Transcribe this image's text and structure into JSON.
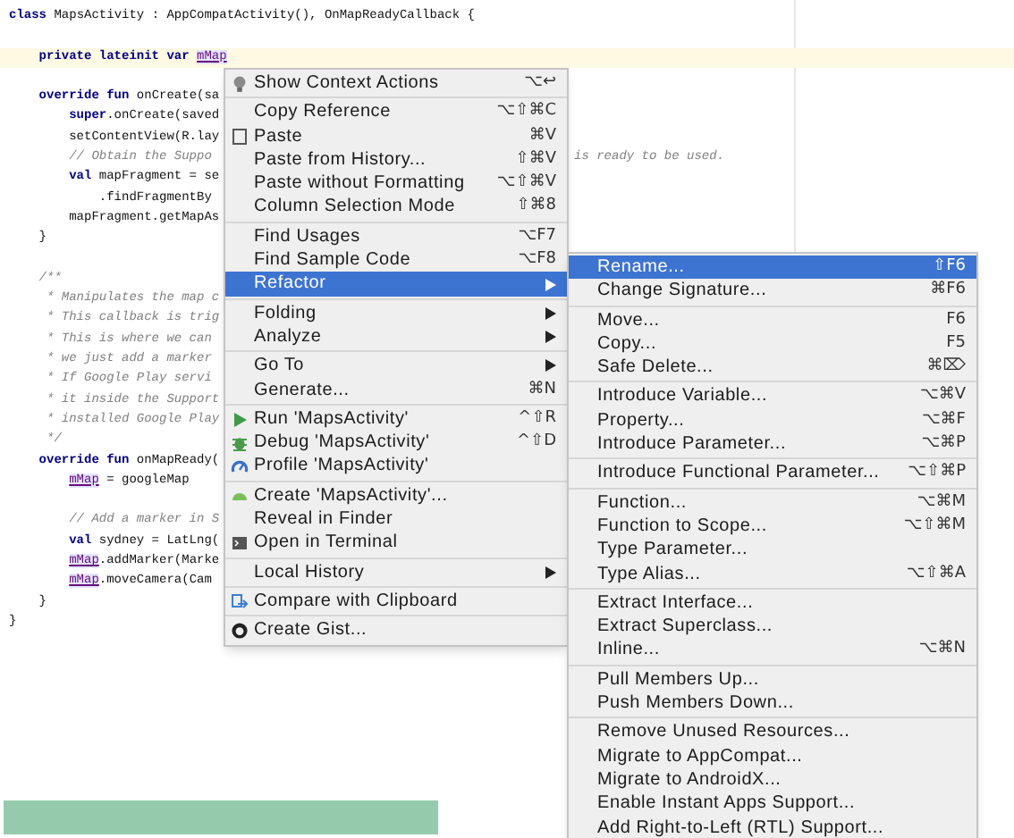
{
  "editor": {
    "lines": [
      {
        "kind": "code",
        "current": false,
        "segments": [
          {
            "kind": "keyword",
            "text": "class"
          },
          {
            "kind": "plain",
            "text": " MapsActivity : AppCompatActivity(), OnMapReadyCallback {"
          }
        ],
        "children": [
          {
            "kind": "blank",
            "current": false
          },
          {
            "kind": "code",
            "current": true,
            "segments": [
              {
                "kind": "keyword",
                "text": "private lateinit var "
              },
              {
                "kind": "field",
                "text": "mMap"
              }
            ]
          },
          {
            "kind": "blank",
            "current": false
          },
          {
            "kind": "code",
            "current": false,
            "segments": [
              {
                "kind": "keyword",
                "text": "override fun"
              },
              {
                "kind": "plain",
                "text": " onCreate(sa"
              }
            ],
            "children": [
              {
                "kind": "code",
                "current": false,
                "segments": [
                  {
                    "kind": "keyword",
                    "text": "super"
                  },
                  {
                    "kind": "plain",
                    "text": ".onCreate(saved"
                  }
                ]
              },
              {
                "kind": "code",
                "current": false,
                "segments": [
                  {
                    "kind": "plain",
                    "text": "setContentView(R.lay"
                  }
                ]
              },
              {
                "kind": "code",
                "current": false,
                "segments": [
                  {
                    "kind": "comment",
                    "text": "// Obtain the Suppo"
                  }
                ],
                "tail": "is ready to be used."
              },
              {
                "kind": "code",
                "current": false,
                "segments": [
                  {
                    "kind": "keyword",
                    "text": "val"
                  },
                  {
                    "kind": "plain",
                    "text": " mapFragment = se"
                  }
                ],
                "children": [
                  {
                    "kind": "code",
                    "current": false,
                    "segments": [
                      {
                        "kind": "plain",
                        "text": ".findFragmentBy"
                      }
                    ]
                  }
                ]
              },
              {
                "kind": "code",
                "current": false,
                "segments": [
                  {
                    "kind": "plain",
                    "text": "mapFragment.getMapAs"
                  }
                ]
              }
            ]
          },
          {
            "kind": "code",
            "current": false,
            "segments": [
              {
                "kind": "plain",
                "text": "}"
              }
            ]
          },
          {
            "kind": "blank",
            "current": false
          },
          {
            "kind": "code",
            "current": false,
            "segments": [
              {
                "kind": "comment",
                "text": "/**"
              }
            ]
          },
          {
            "kind": "code",
            "current": false,
            "segments": [
              {
                "kind": "comment",
                "text": " * Manipulates the map c"
              }
            ]
          },
          {
            "kind": "code",
            "current": false,
            "segments": [
              {
                "kind": "comment",
                "text": " * This callback is trig"
              }
            ]
          },
          {
            "kind": "code",
            "current": false,
            "segments": [
              {
                "kind": "comment",
                "text": " * This is where we can"
              }
            ]
          },
          {
            "kind": "code",
            "current": false,
            "segments": [
              {
                "kind": "comment",
                "text": " * we just add a marker"
              }
            ]
          },
          {
            "kind": "code",
            "current": false,
            "segments": [
              {
                "kind": "comment",
                "text": " * If Google Play servi"
              }
            ]
          },
          {
            "kind": "code",
            "current": false,
            "segments": [
              {
                "kind": "comment",
                "text": " * it inside the Support"
              }
            ]
          },
          {
            "kind": "code",
            "current": false,
            "segments": [
              {
                "kind": "comment",
                "text": " * installed Google Play"
              }
            ]
          },
          {
            "kind": "code",
            "current": false,
            "segments": [
              {
                "kind": "comment",
                "text": " */"
              }
            ]
          },
          {
            "kind": "code",
            "current": false,
            "segments": [
              {
                "kind": "keyword",
                "text": "override fun"
              },
              {
                "kind": "plain",
                "text": " onMapReady("
              }
            ],
            "children": [
              {
                "kind": "code",
                "current": false,
                "segments": [
                  {
                    "kind": "field",
                    "text": "mMap"
                  },
                  {
                    "kind": "plain",
                    "text": " = googleMap"
                  }
                ]
              },
              {
                "kind": "blank",
                "current": false
              },
              {
                "kind": "code",
                "current": false,
                "segments": [
                  {
                    "kind": "comment",
                    "text": "// Add a marker in S"
                  }
                ]
              },
              {
                "kind": "code",
                "current": false,
                "segments": [
                  {
                    "kind": "keyword",
                    "text": "val"
                  },
                  {
                    "kind": "plain",
                    "text": " sydney = LatLng("
                  }
                ]
              },
              {
                "kind": "code",
                "current": false,
                "segments": [
                  {
                    "kind": "field",
                    "text": "mMap"
                  },
                  {
                    "kind": "plain",
                    "text": ".addMarker(Marke"
                  }
                ]
              },
              {
                "kind": "code",
                "current": false,
                "segments": [
                  {
                    "kind": "field",
                    "text": "mMap"
                  },
                  {
                    "kind": "plain",
                    "text": ".moveCamera(Cam"
                  }
                ]
              }
            ]
          },
          {
            "kind": "code",
            "current": false,
            "segments": [
              {
                "kind": "plain",
                "text": "}"
              }
            ]
          }
        ]
      },
      {
        "kind": "code",
        "current": false,
        "segments": [
          {
            "kind": "plain",
            "text": "}"
          }
        ]
      }
    ]
  },
  "context_menu": {
    "groups": [
      [
        {
          "label": "Show Context Actions",
          "shortcut": "⌥↩",
          "submenu": false,
          "selected": false
        }
      ],
      [
        {
          "label": "Copy Reference",
          "shortcut": "⌥⇧⌘C",
          "submenu": false,
          "selected": false
        },
        {
          "label": "Paste",
          "shortcut": "⌘V",
          "submenu": false,
          "selected": false
        },
        {
          "label": "Paste from History...",
          "shortcut": "⇧⌘V",
          "submenu": false,
          "selected": false
        },
        {
          "label": "Paste without Formatting",
          "shortcut": "⌥⇧⌘V",
          "submenu": false,
          "selected": false
        },
        {
          "label": "Column Selection Mode",
          "shortcut": "⇧⌘8",
          "submenu": false,
          "selected": false
        }
      ],
      [
        {
          "label": "Find Usages",
          "shortcut": "⌥F7",
          "submenu": false,
          "selected": false
        },
        {
          "label": "Find Sample Code",
          "shortcut": "⌥F8",
          "submenu": false,
          "selected": false
        },
        {
          "label": "Refactor",
          "submenu": true,
          "selected": true
        }
      ],
      [
        {
          "label": "Folding",
          "submenu": true,
          "selected": false
        },
        {
          "label": "Analyze",
          "submenu": true,
          "selected": false
        }
      ],
      [
        {
          "label": "Go To",
          "submenu": true,
          "selected": false
        },
        {
          "label": "Generate...",
          "shortcut": "⌘N",
          "submenu": false,
          "selected": false
        }
      ],
      [
        {
          "label": "Run 'MapsActivity'",
          "shortcut": "^⇧R",
          "submenu": false,
          "selected": false
        },
        {
          "label": "Debug 'MapsActivity'",
          "shortcut": "^⇧D",
          "submenu": false,
          "selected": false
        },
        {
          "label": "Profile 'MapsActivity'",
          "submenu": false,
          "selected": false
        }
      ],
      [
        {
          "label": "Create 'MapsActivity'...",
          "submenu": false,
          "selected": false
        },
        {
          "label": "Reveal in Finder",
          "submenu": false,
          "selected": false
        },
        {
          "label": "Open in Terminal",
          "submenu": false,
          "selected": false
        }
      ],
      [
        {
          "label": "Local History",
          "submenu": true,
          "selected": false
        }
      ],
      [
        {
          "label": "Compare with Clipboard",
          "submenu": false,
          "selected": false
        }
      ],
      [
        {
          "label": "Create Gist...",
          "submenu": false,
          "selected": false
        }
      ]
    ]
  },
  "refactor_submenu": {
    "groups": [
      [
        {
          "label": "Rename...",
          "shortcut": "⇧F6",
          "selected": true
        },
        {
          "label": "Change Signature...",
          "shortcut": "⌘F6",
          "selected": false
        }
      ],
      [
        {
          "label": "Move...",
          "shortcut": "F6",
          "selected": false
        },
        {
          "label": "Copy...",
          "shortcut": "F5",
          "selected": false
        },
        {
          "label": "Safe Delete...",
          "shortcut": "⌘⌦",
          "selected": false
        }
      ],
      [
        {
          "label": "Introduce Variable...",
          "shortcut": "⌥⌘V",
          "selected": false
        },
        {
          "label": "Property...",
          "shortcut": "⌥⌘F",
          "selected": false
        },
        {
          "label": "Introduce Parameter...",
          "shortcut": "⌥⌘P",
          "selected": false
        }
      ],
      [
        {
          "label": "Introduce Functional Parameter...",
          "shortcut": "⌥⇧⌘P",
          "selected": false
        }
      ],
      [
        {
          "label": "Function...",
          "shortcut": "⌥⌘M",
          "selected": false
        },
        {
          "label": "Function to Scope...",
          "shortcut": "⌥⇧⌘M",
          "selected": false
        },
        {
          "label": "Type Parameter...",
          "selected": false
        },
        {
          "label": "Type Alias...",
          "shortcut": "⌥⇧⌘A",
          "selected": false
        }
      ],
      [
        {
          "label": "Extract Interface...",
          "selected": false
        },
        {
          "label": "Extract Superclass...",
          "selected": false
        },
        {
          "label": "Inline...",
          "shortcut": "⌥⌘N",
          "selected": false
        }
      ],
      [
        {
          "label": "Pull Members Up...",
          "selected": false
        },
        {
          "label": "Push Members Down...",
          "selected": false
        }
      ],
      [
        {
          "label": "Remove Unused Resources...",
          "selected": false
        },
        {
          "label": "Migrate to AppCompat...",
          "selected": false
        },
        {
          "label": "Migrate to AndroidX...",
          "selected": false
        },
        {
          "label": "Enable Instant Apps Support...",
          "selected": false
        },
        {
          "label": "Add Right-to-Left (RTL) Support...",
          "selected": false
        }
      ]
    ]
  }
}
